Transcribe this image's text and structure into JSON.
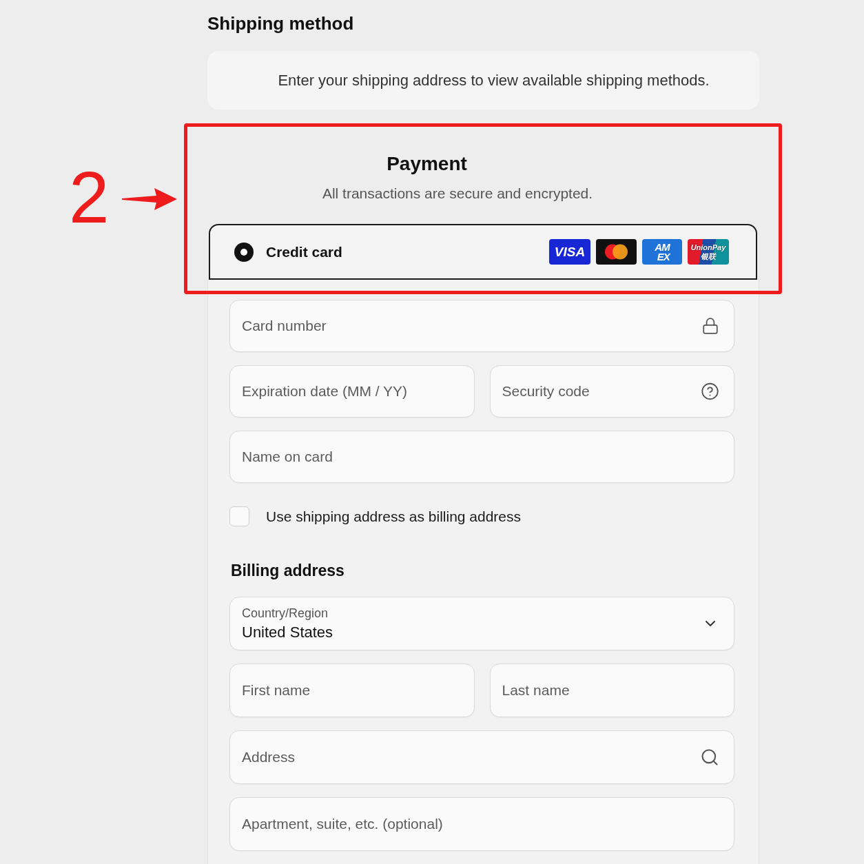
{
  "shipping_method": {
    "title": "Shipping method",
    "notice": "Enter your shipping address to view available shipping methods."
  },
  "annotation": {
    "label": "2"
  },
  "payment": {
    "title": "Payment",
    "subtitle": "All transactions are secure and encrypted.",
    "methods": [
      {
        "label": "Credit card",
        "selected": true,
        "cards": [
          {
            "kind": "visa",
            "text": "VISA"
          },
          {
            "kind": "mastercard"
          },
          {
            "kind": "amex",
            "text": "AM\nEX"
          },
          {
            "kind": "unionpay",
            "text": "UnionPay\n银联"
          }
        ]
      }
    ],
    "card_fields": [
      {
        "fields": [
          {
            "kind": "locked",
            "placeholder": "Card number"
          }
        ]
      },
      {
        "fields": [
          {
            "kind": "plain",
            "placeholder": "Expiration date (MM / YY)"
          },
          {
            "kind": "help",
            "placeholder": "Security code"
          }
        ]
      },
      {
        "fields": [
          {
            "kind": "plain",
            "placeholder": "Name on card"
          }
        ]
      }
    ],
    "billing_same": {
      "label": "Use shipping address as billing address",
      "checked": false
    }
  },
  "billing_address": {
    "title": "Billing address",
    "rows": [
      {
        "fields": [
          {
            "kind": "select",
            "label": "Country/Region",
            "value": "United States"
          }
        ]
      },
      {
        "fields": [
          {
            "kind": "plain",
            "placeholder": "First name"
          },
          {
            "kind": "plain",
            "placeholder": "Last name"
          }
        ]
      },
      {
        "fields": [
          {
            "kind": "search",
            "placeholder": "Address"
          }
        ]
      },
      {
        "fields": [
          {
            "kind": "plain",
            "placeholder": "Apartment, suite, etc. (optional)"
          }
        ]
      }
    ]
  }
}
